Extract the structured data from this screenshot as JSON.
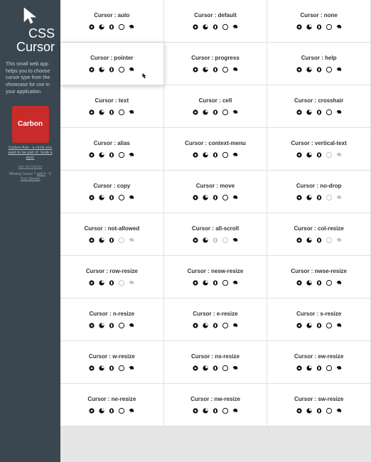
{
  "sidebar": {
    "title_line1": "CSS",
    "title_line2": "Cursor",
    "description": "This small web app helps you to choose cursor type from the showcase for use in your application.",
    "ad_label": "Carbon",
    "ad_caption": "Carbon Ads - a circle you want to be part of. Grab a spot.",
    "ad_via": "ads via Carbon",
    "footer_missing": "Missing Cursor ?",
    "footer_add": "add it",
    "footer_dash": " - © ",
    "footer_author": "Tech Stream"
  },
  "cells": [
    {
      "label": "Cursor : auto",
      "support": [
        1,
        1,
        1,
        1,
        1
      ]
    },
    {
      "label": "Cursor : default",
      "support": [
        1,
        1,
        1,
        1,
        1
      ]
    },
    {
      "label": "Cursor : none",
      "support": [
        1,
        1,
        1,
        1,
        1
      ]
    },
    {
      "label": "Cursor : pointer",
      "support": [
        1,
        1,
        1,
        1,
        1
      ],
      "hovered": true
    },
    {
      "label": "Cursor : progress",
      "support": [
        1,
        1,
        1,
        1,
        1
      ]
    },
    {
      "label": "Cursor : help",
      "support": [
        1,
        1,
        1,
        1,
        1
      ]
    },
    {
      "label": "Cursor : text",
      "support": [
        1,
        1,
        1,
        1,
        1
      ]
    },
    {
      "label": "Cursor : cell",
      "support": [
        1,
        1,
        1,
        1,
        1
      ]
    },
    {
      "label": "Cursor : crosshair",
      "support": [
        1,
        1,
        1,
        1,
        1
      ]
    },
    {
      "label": "Cursor : alias",
      "support": [
        1,
        1,
        1,
        1,
        1
      ]
    },
    {
      "label": "Cursor : context-menu",
      "support": [
        1,
        1,
        1,
        1,
        1
      ]
    },
    {
      "label": "Cursor : vertical-text",
      "support": [
        1,
        1,
        1,
        0,
        0
      ]
    },
    {
      "label": "Cursor : copy",
      "support": [
        1,
        1,
        1,
        1,
        1
      ]
    },
    {
      "label": "Cursor : move",
      "support": [
        1,
        1,
        1,
        1,
        1
      ]
    },
    {
      "label": "Cursor : no-drop",
      "support": [
        1,
        1,
        1,
        0,
        0
      ]
    },
    {
      "label": "Cursor : not-allowed",
      "support": [
        1,
        1,
        1,
        0,
        0
      ]
    },
    {
      "label": "Cursor : all-scroll",
      "support": [
        1,
        1,
        0,
        0,
        1
      ]
    },
    {
      "label": "Cursor : col-resize",
      "support": [
        1,
        1,
        1,
        0,
        0
      ]
    },
    {
      "label": "Cursor : row-resize",
      "support": [
        1,
        1,
        1,
        0,
        0
      ]
    },
    {
      "label": "Cursor : nesw-resize",
      "support": [
        1,
        1,
        1,
        1,
        1
      ]
    },
    {
      "label": "Cursor : nwse-resize",
      "support": [
        1,
        1,
        1,
        1,
        1
      ]
    },
    {
      "label": "Cursor : n-resize",
      "support": [
        1,
        1,
        1,
        1,
        1
      ]
    },
    {
      "label": "Cursor : e-resize",
      "support": [
        1,
        1,
        1,
        1,
        1
      ]
    },
    {
      "label": "Cursor : s-resize",
      "support": [
        1,
        1,
        1,
        1,
        1
      ]
    },
    {
      "label": "Cursor : w-resize",
      "support": [
        1,
        1,
        1,
        1,
        1
      ]
    },
    {
      "label": "Cursor : ns-resize",
      "support": [
        1,
        1,
        1,
        1,
        1
      ]
    },
    {
      "label": "Cursor : ew-resize",
      "support": [
        1,
        1,
        1,
        1,
        1
      ]
    },
    {
      "label": "Cursor : ne-resize",
      "support": [
        1,
        1,
        1,
        1,
        1
      ]
    },
    {
      "label": "Cursor : nw-resize",
      "support": [
        1,
        1,
        1,
        1,
        1
      ]
    },
    {
      "label": "Cursor : sw-resize",
      "support": [
        1,
        1,
        1,
        1,
        1
      ]
    }
  ],
  "browser_icons": [
    "chrome-icon",
    "firefox-icon",
    "opera-icon",
    "safari-icon",
    "ie-icon"
  ]
}
